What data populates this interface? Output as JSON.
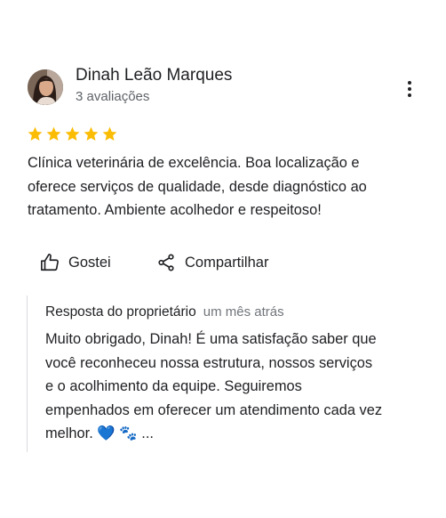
{
  "review": {
    "author_name": "Dinah Leão Marques",
    "review_count": "3 avaliações",
    "rating": 5,
    "rating_max": 5,
    "star_color": "#fbbc04",
    "text": "Clínica veterinária de excelência. Boa localização e\noferece serviços de qualidade, desde diagnóstico ao\ntratamento. Ambiente acolhedor e respeitoso!",
    "more_icon": "more-vert-icon"
  },
  "actions": {
    "like_label": "Gostei",
    "like_icon": "thumbs-up-icon",
    "share_label": "Compartilhar",
    "share_icon": "share-icon"
  },
  "owner_response": {
    "label": "Resposta do proprietário",
    "time": "um mês atrás",
    "text": "Muito obrigado, Dinah! É uma satisfação saber que\nvocê reconheceu nossa estrutura, nossos serviços\ne o acolhimento da equipe. Seguiremos\nempenhados em oferecer um atendimento cada vez\nmelhor.",
    "emoji_heart": "💙",
    "emoji_paws": "🐾",
    "ellipsis": "..."
  }
}
